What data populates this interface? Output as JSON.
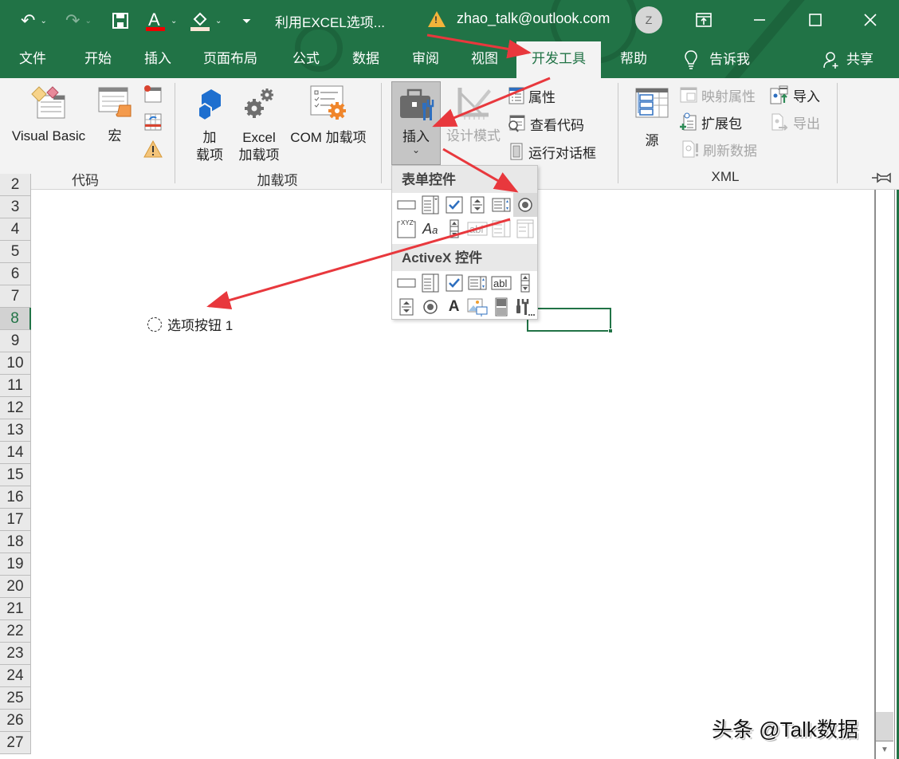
{
  "app": {
    "document_title": "利用EXCEL选项...",
    "account": "zhao_talk@outlook.com",
    "avatar_initial": "Z",
    "accent_color": "#217346"
  },
  "quick_access": {
    "undo": "undo-icon",
    "redo": "redo-icon",
    "save": "save-icon",
    "font_color": "font-color-icon",
    "fill_color": "fill-color-icon",
    "customize": "customize-icon"
  },
  "window_controls": {
    "ribbon_display": "▣",
    "minimize": "—",
    "maximize": "☐",
    "close": "✕"
  },
  "tabs": [
    {
      "label": "文件"
    },
    {
      "label": "开始"
    },
    {
      "label": "插入"
    },
    {
      "label": "页面布局"
    },
    {
      "label": "公式"
    },
    {
      "label": "数据"
    },
    {
      "label": "审阅"
    },
    {
      "label": "视图"
    },
    {
      "label": "开发工具",
      "active": true
    },
    {
      "label": "帮助"
    },
    {
      "label": "告诉我"
    },
    {
      "label": "共享"
    }
  ],
  "ribbon": {
    "groups": {
      "code": {
        "label": "代码",
        "visual_basic": "Visual Basic",
        "macros": "宏"
      },
      "addins": {
        "label": "加载项",
        "addins_line1": "加",
        "addins_line2": "载项",
        "excel_addins_line1": "Excel",
        "excel_addins_line2": "加载项",
        "com_addins": "COM 加载项"
      },
      "controls": {
        "insert": "插入",
        "insert_chevron": "⌄",
        "design_mode": "设计模式",
        "properties": "属性",
        "view_code": "查看代码",
        "run_dialog": "运行对话框"
      },
      "xml": {
        "label": "XML",
        "source": "源",
        "map_properties": "映射属性",
        "expansion_packs": "扩展包",
        "refresh_data": "刷新数据",
        "import": "导入",
        "export": "导出"
      }
    }
  },
  "insert_dropdown": {
    "form_controls_label": "表单控件",
    "activex_controls_label": "ActiveX 控件",
    "form_controls": [
      "button",
      "combo-box",
      "check-box",
      "spin-button",
      "list-box",
      "option-button",
      "group-box",
      "label",
      "scroll-bar",
      "text-field",
      "combo-list-edit",
      "combo-drop-down-edit"
    ],
    "activex_controls": [
      "command-button",
      "combo-box",
      "check-box",
      "list-box",
      "text-box",
      "scroll-bar",
      "spin-button",
      "option-button",
      "label",
      "image",
      "toggle-button",
      "more-controls"
    ]
  },
  "sheet": {
    "rows": [
      "2",
      "3",
      "4",
      "5",
      "6",
      "7",
      "8",
      "9",
      "10",
      "11",
      "12",
      "13",
      "14",
      "15",
      "16",
      "17",
      "18",
      "19",
      "20",
      "21",
      "22",
      "23",
      "24",
      "25",
      "26",
      "27"
    ],
    "selected_row": "8",
    "option_button_label": "选项按钮 1"
  },
  "watermark": "头条 @Talk数据"
}
